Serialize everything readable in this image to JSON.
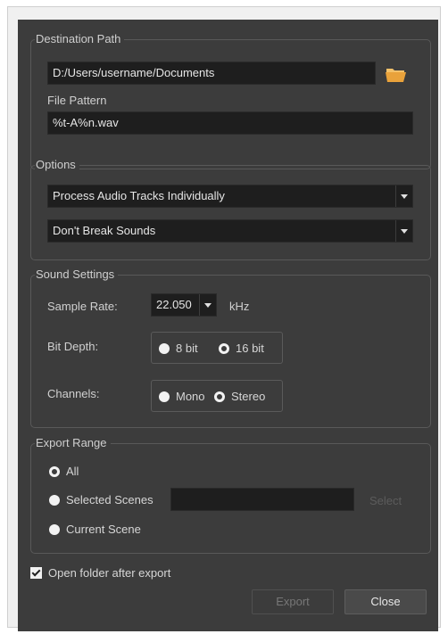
{
  "destination": {
    "title": "Destination Path",
    "path_value": "D:/Users/username/Documents",
    "file_pattern_label": "File Pattern",
    "file_pattern_value": "%t-A%n.wav"
  },
  "options": {
    "title": "Options",
    "track_mode": "Process Audio Tracks Individually",
    "break_mode": "Don't Break Sounds"
  },
  "sound": {
    "title": "Sound Settings",
    "sample_rate_label": "Sample Rate:",
    "sample_rate_value": "22.050",
    "sample_rate_unit": "kHz",
    "bit_depth_label": "Bit Depth:",
    "bit_8": "8 bit",
    "bit_16": "16 bit",
    "channels_label": "Channels:",
    "mono": "Mono",
    "stereo": "Stereo"
  },
  "range": {
    "title": "Export Range",
    "all": "All",
    "selected_scenes": "Selected Scenes",
    "select_button": "Select",
    "current_scene": "Current Scene"
  },
  "footer": {
    "open_folder_label": "Open folder after export",
    "export_button": "Export",
    "close_button": "Close"
  },
  "colors": {
    "dialog_bg": "#3c3c3c",
    "field_bg": "#1e1e1e",
    "folder_icon": "#e9a23b"
  }
}
